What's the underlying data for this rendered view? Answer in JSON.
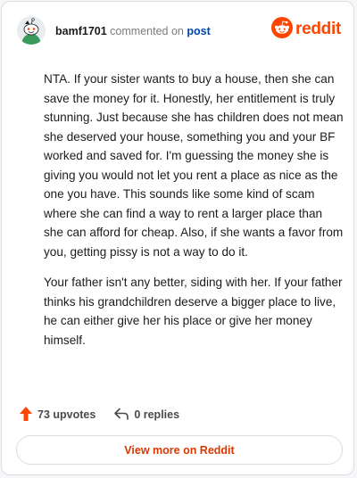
{
  "header": {
    "username": "bamf1701",
    "action_text": "commented on",
    "post_link": "post",
    "brand": "reddit"
  },
  "comment": {
    "paragraphs": [
      "NTA. If your sister wants to buy a house, then she can save the money for it. Honestly, her entitlement is truly stunning. Just because she has children does not mean she deserved your house, something you and your BF worked and saved for. I'm guessing the money she is giving you would not let you rent a place as nice as the one you have. This sounds like some kind of scam where she can find a way to rent a larger place than she can afford for cheap. Also, if she wants a favor from you, getting pissy is not a way to do it.",
      "Your father isn't any better, siding with her. If your father thinks his grandchildren deserve a bigger place to live, he can either give her his place or give her money himself."
    ]
  },
  "footer": {
    "upvotes": "73 upvotes",
    "replies": "0 replies",
    "view_more": "View more on Reddit"
  },
  "colors": {
    "brand": "#ff4500",
    "upvote": "#ff4500",
    "link": "#0045ac",
    "view_more_text": "#d93900"
  },
  "icons": {
    "avatar": "snoo-avatar-icon",
    "brand": "reddit-logo-icon",
    "upvote": "upvote-arrow-icon",
    "reply": "reply-arrow-icon"
  }
}
